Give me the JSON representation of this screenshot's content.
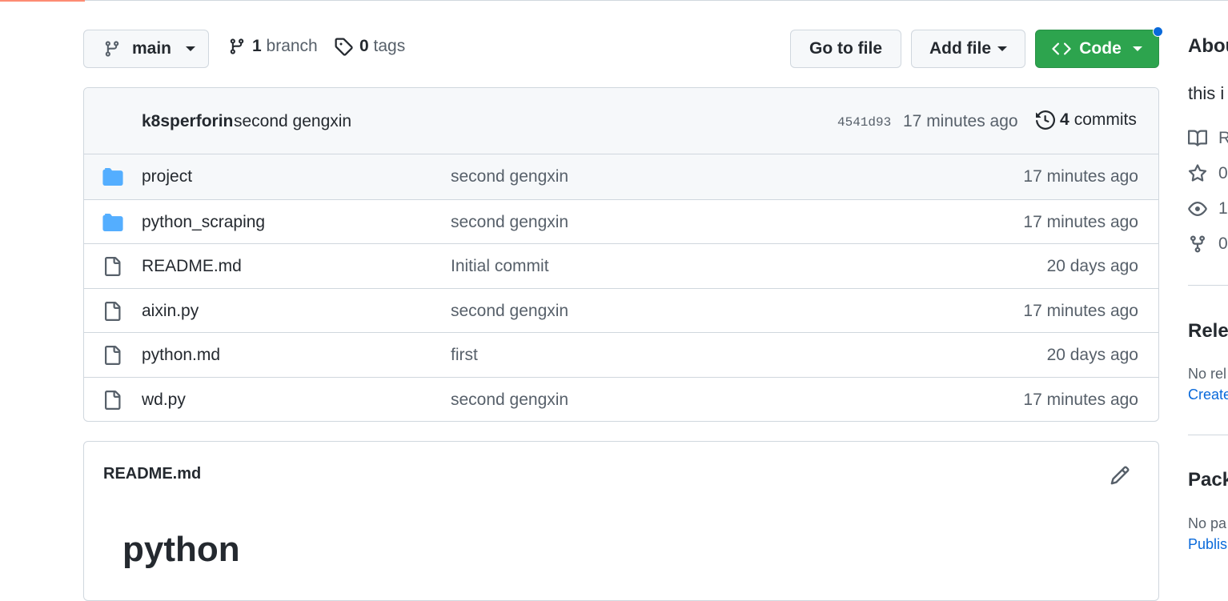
{
  "toolbar": {
    "branch_name": "main",
    "branch_count": "1",
    "branch_label": "branch",
    "tag_count": "0",
    "tag_label": "tags",
    "go_to_file": "Go to file",
    "add_file": "Add file",
    "code": "Code"
  },
  "commit": {
    "author": "k8sperforin",
    "message": "second gengxin",
    "sha": "4541d93",
    "time": "17 minutes ago",
    "count": "4",
    "count_label": "commits"
  },
  "files": [
    {
      "name": "project",
      "type": "folder",
      "message": "second gengxin",
      "time": "17 minutes ago"
    },
    {
      "name": "python_scraping",
      "type": "folder",
      "message": "second gengxin",
      "time": "17 minutes ago"
    },
    {
      "name": "README.md",
      "type": "file",
      "message": "Initial commit",
      "time": "20 days ago"
    },
    {
      "name": "aixin.py",
      "type": "file",
      "message": "second gengxin",
      "time": "17 minutes ago"
    },
    {
      "name": "python.md",
      "type": "file",
      "message": "first",
      "time": "20 days ago"
    },
    {
      "name": "wd.py",
      "type": "file",
      "message": "second gengxin",
      "time": "17 minutes ago"
    }
  ],
  "readme": {
    "title": "README.md",
    "heading": "python"
  },
  "sidebar": {
    "about_title": "Abou",
    "description": "this i",
    "readme_label": "R",
    "stars": "0",
    "watchers": "1",
    "forks": "0",
    "releases_title": "Relea",
    "releases_text": "No rel",
    "releases_link": "Create",
    "packages_title": "Pack",
    "packages_text": "No pa",
    "packages_link": "Publisl"
  },
  "colors": {
    "accent_green": "#2da44e",
    "link_blue": "#0969da",
    "folder_blue": "#54aeff",
    "muted_text": "#57606a"
  }
}
